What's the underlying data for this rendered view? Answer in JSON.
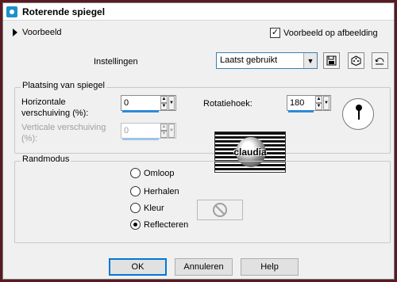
{
  "window": {
    "title": "Roterende spiegel"
  },
  "preview": {
    "toggle_label": "Voorbeeld",
    "checkbox_label": "Voorbeeld op afbeelding",
    "checkbox_checked": true
  },
  "settings": {
    "label": "Instellingen",
    "preset_value": "Laatst gebruikt"
  },
  "placement": {
    "group_title": "Plaatsing van spiegel",
    "horizontal_label_1": "Horizontale",
    "horizontal_label_2": "verschuiving (%):",
    "horizontal_value": "0",
    "vertical_label_1": "Verticale verschuiving",
    "vertical_label_2": "(%):",
    "vertical_value": "0",
    "rotation_label": "Rotatiehoek:",
    "rotation_value": "180"
  },
  "preview_image": {
    "text": "claudia"
  },
  "edge_mode": {
    "group_title": "Randmodus",
    "options": [
      "Omloop",
      "Herhalen",
      "Kleur",
      "Reflecteren"
    ],
    "selected": "Reflecteren"
  },
  "buttons": {
    "ok": "OK",
    "cancel": "Annuleren",
    "help": "Help"
  }
}
